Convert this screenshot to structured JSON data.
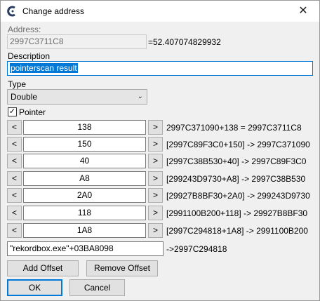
{
  "window": {
    "title": "Change address"
  },
  "address": {
    "label": "Address:",
    "value": "2997C3711C8",
    "result": "=52.407074829932"
  },
  "description": {
    "label": "Description",
    "value": "pointerscan result"
  },
  "type": {
    "label": "Type",
    "selected": "Double"
  },
  "pointer": {
    "label": "Pointer",
    "checked": true,
    "offsets": [
      {
        "value": "138",
        "result": "2997C371090+138 = 2997C3711C8"
      },
      {
        "value": "150",
        "result": "[2997C89F3C0+150] -> 2997C371090"
      },
      {
        "value": "40",
        "result": "[2997C38B530+40] -> 2997C89F3C0"
      },
      {
        "value": "A8",
        "result": "[299243D9730+A8] -> 2997C38B530"
      },
      {
        "value": "2A0",
        "result": "[29927B8BF30+2A0] -> 299243D9730"
      },
      {
        "value": "118",
        "result": "[2991100B200+118] -> 29927B8BF30"
      },
      {
        "value": "1A8",
        "result": "[2997C294818+1A8] -> 2991100B200"
      }
    ],
    "base": {
      "value": "\"rekordbox.exe\"+03BA8098",
      "result": "->2997C294818"
    },
    "dec_label": "<",
    "inc_label": ">"
  },
  "buttons": {
    "add_offset": "Add Offset",
    "remove_offset": "Remove Offset",
    "ok": "OK",
    "cancel": "Cancel"
  },
  "icons": {
    "app": "cheat-engine-icon",
    "close": "close-icon",
    "dropdown": "chevron-down-icon",
    "check": "checkmark-icon"
  },
  "colors": {
    "selection": "#0078d7",
    "focus_border": "#0078d7"
  }
}
